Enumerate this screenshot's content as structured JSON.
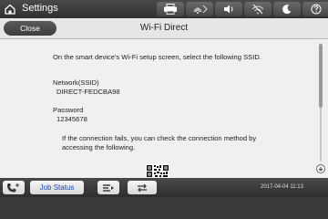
{
  "topbar": {
    "title": "Settings",
    "status_icons": [
      "printer-icon",
      "wifi-direct-icon",
      "volume-icon",
      "wifi-off-icon",
      "sleep-moon-icon",
      "help-icon"
    ]
  },
  "header": {
    "close_label": "Close",
    "title": "Wi-Fi Direct"
  },
  "content": {
    "instruction": "On the smart device's Wi-Fi setup screen, select the following SSID.",
    "network_label": "Network(SSID)",
    "network_value": "DIRECT-FEDCBA98",
    "password_label": "Password",
    "password_value": "12345678",
    "fail_line1": "If the connection fails, you can check the connection method by",
    "fail_line2": "accessing the following."
  },
  "bottombar": {
    "job_status_label": "Job Status",
    "datetime": "2017-04-04 11:13"
  }
}
